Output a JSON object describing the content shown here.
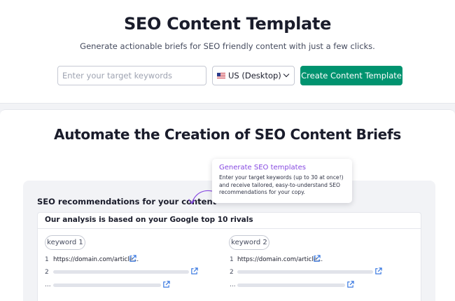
{
  "hero": {
    "title": "SEO Content Template",
    "subtitle": "Generate actionable briefs for SEO friendly content with just a few clicks.",
    "keyword_placeholder": "Enter your target keywords",
    "database_value": "US (Desktop)",
    "cta_label": "Create Content Template"
  },
  "section": {
    "title": "Automate the Creation of SEO Content Briefs"
  },
  "preview": {
    "title": "SEO recommendations for your content",
    "tooltip_title": "Generate SEO templates",
    "tooltip_body": "Enter your target keywords (up to 30 at once!) and receive tailored, easy-to-understand SEO recommendations for your copy.",
    "card_title": "Our analysis is based on your Google top 10 rivals",
    "columns": [
      {
        "keyword": "keyword 1",
        "rows": [
          {
            "num": "1",
            "url": "https://domain.com/article..."
          },
          {
            "num": "2"
          },
          {
            "num": "..."
          }
        ]
      },
      {
        "keyword": "keyword 2",
        "rows": [
          {
            "num": "1",
            "url": "https://domain.com/article..."
          },
          {
            "num": "2"
          },
          {
            "num": "..."
          }
        ]
      }
    ]
  },
  "colors": {
    "accent": "#00936f",
    "tooltip_title": "#8649e1",
    "link_icon": "#2b6fdf"
  },
  "icons": {
    "flag": "us-flag-icon",
    "dropdown": "chevron-down-icon",
    "arrow": "curved-arrow-icon",
    "link": "external-link-icon"
  }
}
